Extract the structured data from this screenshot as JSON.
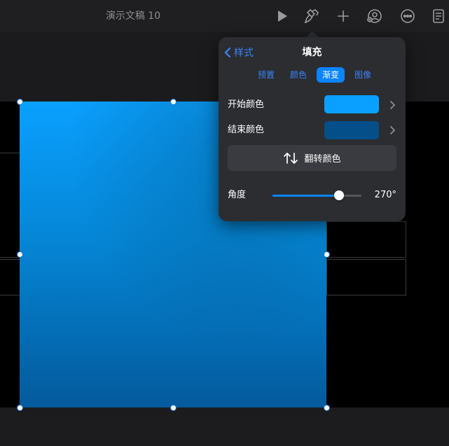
{
  "document": {
    "title": "演示文稿 10"
  },
  "toolbar": {
    "icons": [
      "play-icon",
      "paintbrush-icon",
      "plus-icon",
      "collaborate-icon",
      "more-icon",
      "document-icon"
    ]
  },
  "popover": {
    "back_label": "样式",
    "title": "填充",
    "tabs": [
      {
        "label": "预置",
        "active": false
      },
      {
        "label": "颜色",
        "active": false
      },
      {
        "label": "渐变",
        "active": true
      },
      {
        "label": "图像",
        "active": false
      }
    ],
    "start_color": {
      "label": "开始颜色",
      "value": "#0aa0ff"
    },
    "end_color": {
      "label": "结束颜色",
      "value": "#044f8a"
    },
    "flip_button": "翻转颜色",
    "angle": {
      "label": "角度",
      "value_text": "270°",
      "value": 270,
      "max": 360
    }
  },
  "colors": {
    "accent": "#0a84ff",
    "gradient_start": "#0aa0ff",
    "gradient_end": "#045a9c"
  }
}
